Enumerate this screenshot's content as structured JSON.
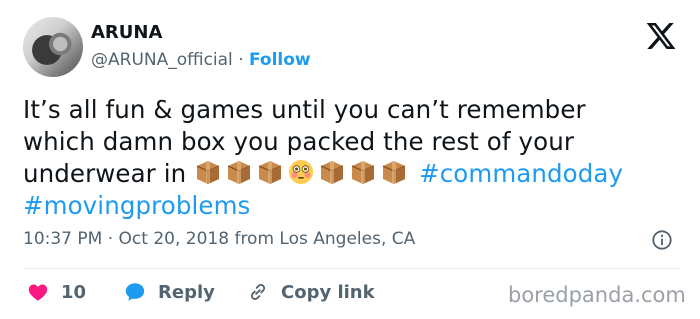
{
  "author": {
    "name": "ARUNA",
    "handle": "@ARUNA_official",
    "separator": "·",
    "follow_label": "Follow"
  },
  "tweet": {
    "text_line1": "It’s all fun & games until you can’t remember",
    "text_line2": "which damn box you packed the rest of your",
    "text_line3": "underwear in",
    "emojis": [
      "package",
      "package",
      "package",
      "flushed-face",
      "package",
      "package",
      "package"
    ],
    "hashtags": [
      "#commandoday",
      "#movingproblems"
    ]
  },
  "meta": {
    "time": "10:37 PM",
    "separator": "·",
    "date": "Oct 20, 2018",
    "location": "from Los Angeles, CA"
  },
  "actions": {
    "like_count": "10",
    "reply_label": "Reply",
    "copy_link_label": "Copy link"
  },
  "watermark": "boredpanda.com",
  "colors": {
    "accent": "#1d9bf0",
    "like": "#f91880",
    "text": "#0f1419",
    "muted": "#536471"
  }
}
